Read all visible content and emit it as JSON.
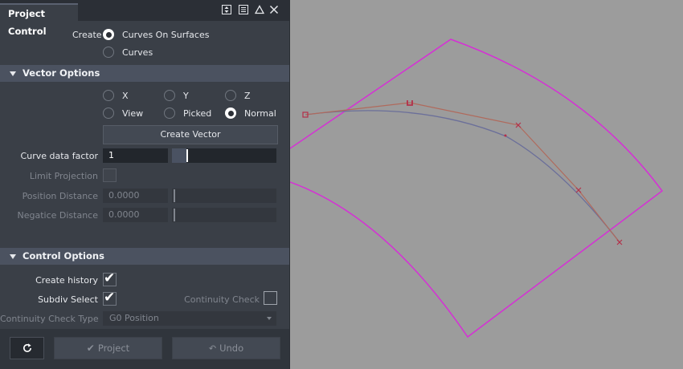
{
  "panel": {
    "title": "Project Control",
    "icons": [
      "resize-icon",
      "menu-icon",
      "collapse-icon",
      "close-icon"
    ]
  },
  "create": {
    "label": "Create",
    "options": [
      {
        "label": "Curves On Surfaces",
        "selected": true
      },
      {
        "label": "Curves",
        "selected": false
      }
    ]
  },
  "vector_options": {
    "title": "Vector Options",
    "options": [
      {
        "label": "X",
        "selected": false
      },
      {
        "label": "Y",
        "selected": false
      },
      {
        "label": "Z",
        "selected": false
      },
      {
        "label": "View",
        "selected": false
      },
      {
        "label": "Picked",
        "selected": false
      },
      {
        "label": "Normal",
        "selected": true
      }
    ],
    "create_vector_label": "Create Vector",
    "curve_data_factor_label": "Curve data factor",
    "curve_data_factor_value": "1",
    "limit_projection_label": "Limit Projection",
    "position_distance_label": "Position Distance",
    "position_distance_value": "0.0000",
    "negatice_distance_label": "Negatice Distance",
    "negatice_distance_value": "0.0000"
  },
  "control_options": {
    "title": "Control Options",
    "create_history_label": "Create history",
    "create_history_checked": true,
    "subdiv_select_label": "Subdiv Select",
    "subdiv_select_checked": true,
    "continuity_check_label": "Continuity Check",
    "continuity_check_checked": false,
    "continuity_check_type_label": "Continuity Check Type",
    "continuity_check_type_value": "G0 Position"
  },
  "actions": {
    "reset_icon": "reset-icon",
    "project_label": "Project",
    "undo_label": "Undo"
  },
  "colors": {
    "panel_bg": "#3a3f47",
    "section_bg": "#4b5260",
    "viewport_bg": "#9c9c9c",
    "surface_edge": "#d62fd6",
    "control_hull": "#b06a5c",
    "curve": "#6b6f9a"
  }
}
